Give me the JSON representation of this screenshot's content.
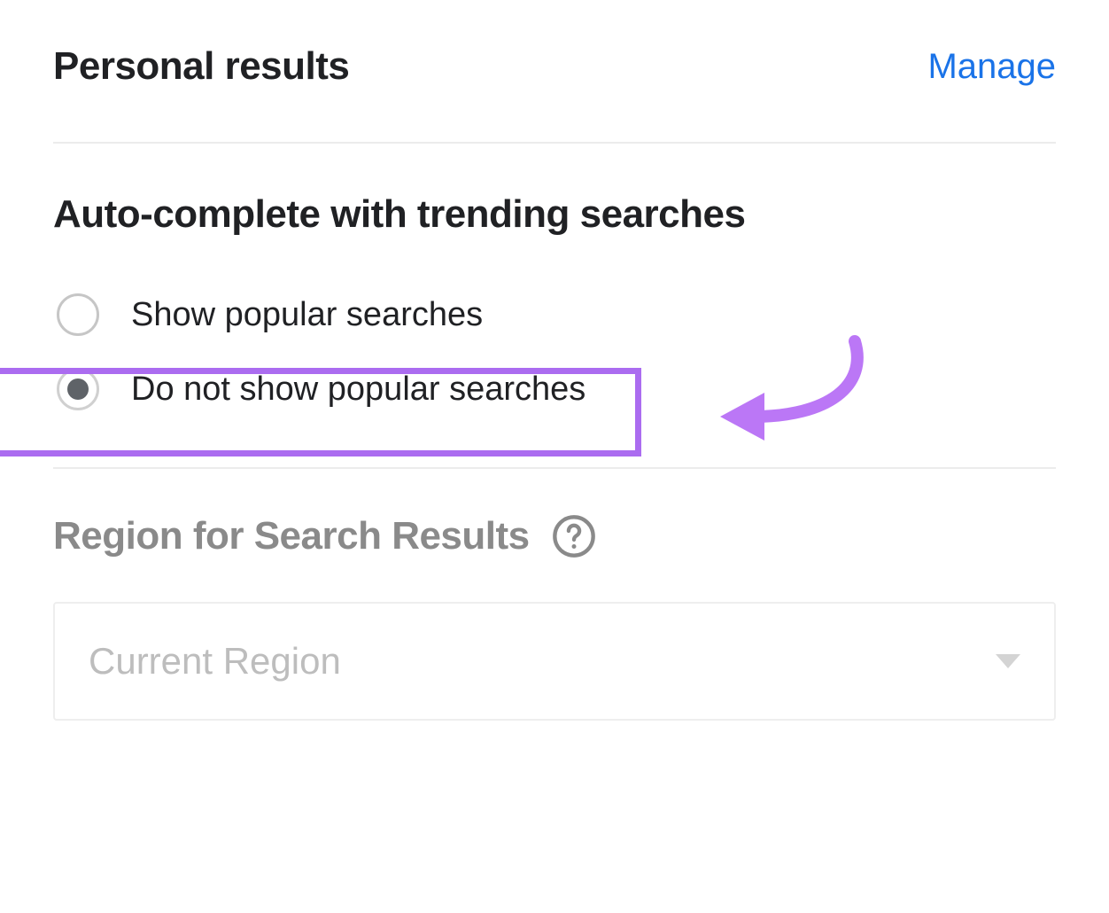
{
  "personal_results": {
    "title": "Personal results",
    "manage_label": "Manage"
  },
  "autocomplete": {
    "title": "Auto-complete with trending searches",
    "options": [
      {
        "label": "Show popular searches",
        "selected": false
      },
      {
        "label": "Do not show popular searches",
        "selected": true
      }
    ]
  },
  "region": {
    "title": "Region for Search Results",
    "help_icon": "help-icon",
    "selected_value": "Current Region"
  },
  "annotation": {
    "highlight_color": "#ab6cf0",
    "arrow_color": "#bb77f6"
  }
}
